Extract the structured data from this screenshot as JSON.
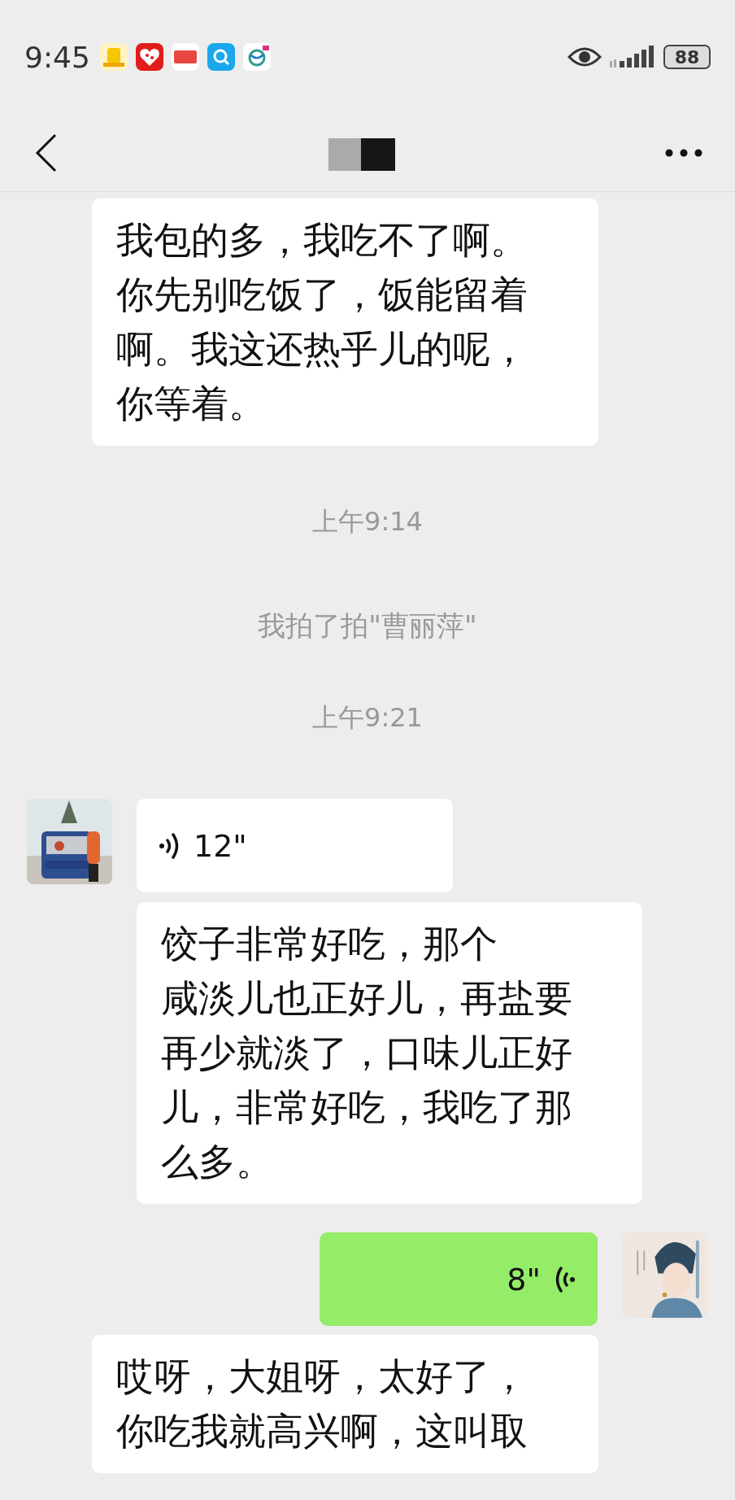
{
  "status_bar": {
    "time": "9:45",
    "battery": "88"
  },
  "messages": [
    {
      "kind": "transcript",
      "sent": true,
      "lines": [
        "我包的多，我吃不了啊。",
        "你先别吃饭了，饭能留着",
        "啊。我这还热乎儿的呢，",
        "你等着。"
      ]
    },
    {
      "kind": "time",
      "text": "上午9:14"
    },
    {
      "kind": "system",
      "text": "我拍了拍\"曹丽萍\""
    },
    {
      "kind": "time",
      "text": "上午9:21"
    },
    {
      "kind": "voice",
      "sent": false,
      "duration": "12\""
    },
    {
      "kind": "transcript",
      "sent": false,
      "lines": [
        "饺子非常好吃，那个",
        "咸淡儿也正好儿，再盐要",
        "再少就淡了，口味儿正好",
        "儿，非常好吃，我吃了那",
        "么多。"
      ]
    },
    {
      "kind": "voice",
      "sent": true,
      "duration": "8\""
    },
    {
      "kind": "transcript",
      "sent": true,
      "lines": [
        "哎呀，大姐呀，太好了，",
        "你吃我就高兴啊，这叫取"
      ]
    }
  ]
}
